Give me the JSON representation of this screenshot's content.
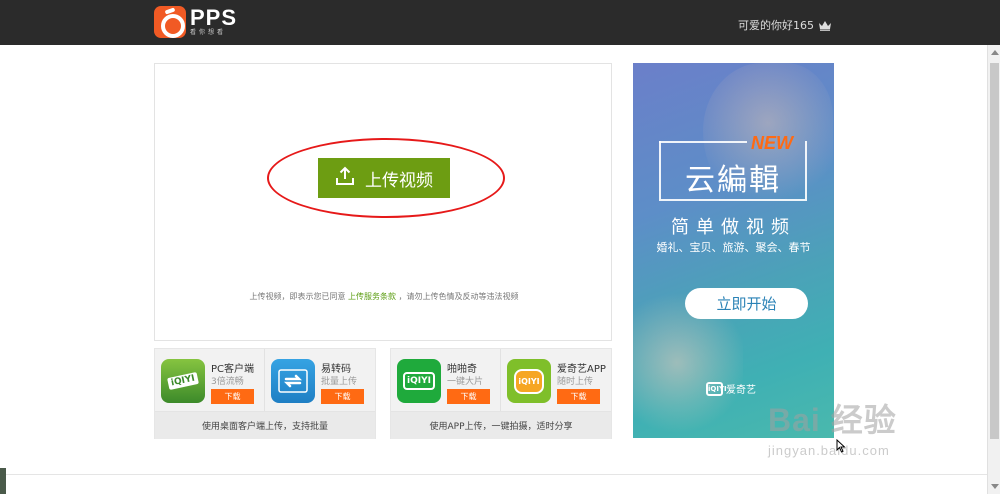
{
  "header": {
    "logo_text": "PPS",
    "logo_sub": "看你想看",
    "greeting": "可爱的你好165"
  },
  "upload": {
    "button_label": "上传视频",
    "terms_prefix": "上传视频，即表示您已同意",
    "terms_link": "上传服务条款",
    "terms_suffix": "，请勿上传色情及反动等违法视频"
  },
  "desktop_panel": {
    "apps": [
      {
        "name": "PC客户端",
        "desc": "3倍流畅",
        "download": "下载",
        "icon_text": "iQIYI"
      },
      {
        "name": "易转码",
        "desc": "批量上传",
        "download": "下载",
        "icon_text": ""
      }
    ],
    "caption": "使用桌面客户端上传，支持批量"
  },
  "mobile_panel": {
    "apps": [
      {
        "name": "啪啪奇",
        "desc": "一键大片",
        "download": "下载",
        "icon_text": "iQIYI"
      },
      {
        "name": "爱奇艺APP",
        "desc": "随时上传",
        "download": "下载",
        "icon_text": "iQIYI"
      }
    ],
    "caption": "使用APP上传，一键拍摄，适时分享"
  },
  "ad": {
    "badge": "NEW",
    "title": "云編輯",
    "subtitle": "简单做视频",
    "tags": "婚礼、宝贝、旅游、聚会、春节",
    "cta": "立即开始",
    "brand": "爱奇艺",
    "brand_mark": "iQIYI"
  },
  "watermark": {
    "main": "Bai 经验",
    "url": "jingyan.baidu.com"
  },
  "colors": {
    "topbar": "#2b2b2b",
    "upload_green": "#6d9d12",
    "download_orange": "#ff6a13",
    "annotation_red": "#e61919"
  }
}
